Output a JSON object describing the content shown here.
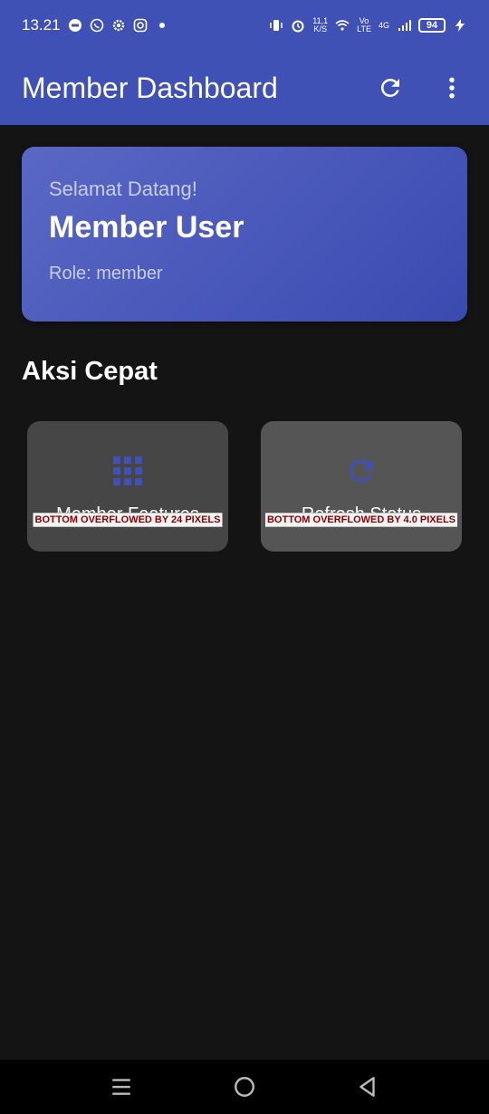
{
  "status_bar": {
    "time": "13.21",
    "net_speed_value": "11,1",
    "net_speed_unit": "K/S",
    "volte_top": "Vo",
    "volte_bottom": "LTE",
    "network_type": "4G",
    "battery_level": "94",
    "icons": [
      "messenger-icon",
      "whatsapp-icon",
      "settings-gear-icon",
      "instagram-icon",
      "dot-icon",
      "vibrate-icon",
      "alarm-icon",
      "wifi-icon",
      "signal-icon",
      "charging-bolt-icon"
    ]
  },
  "app_bar": {
    "title": "Member Dashboard",
    "actions": [
      "refresh-icon",
      "more-vert-icon"
    ]
  },
  "welcome": {
    "greeting": "Selamat Datang!",
    "name": "Member User",
    "role": "Role: member"
  },
  "quick_actions": {
    "title": "Aksi Cepat",
    "items": [
      {
        "label": "Member Features",
        "icon": "apps-grid-icon",
        "overflow_text": "BOTTOM OVERFLOWED BY 24 PIXELS"
      },
      {
        "label": "Refresh Status",
        "icon": "refresh-icon",
        "overflow_text": "BOTTOM OVERFLOWED BY 4.0 PIXELS"
      }
    ]
  },
  "colors": {
    "primary": "#3F51B5",
    "background": "#141414",
    "card": "#464646",
    "overflow_text": "#8B0000"
  },
  "nav_bar": {
    "buttons": [
      "menu-icon",
      "home-circle-icon",
      "back-triangle-icon"
    ]
  }
}
